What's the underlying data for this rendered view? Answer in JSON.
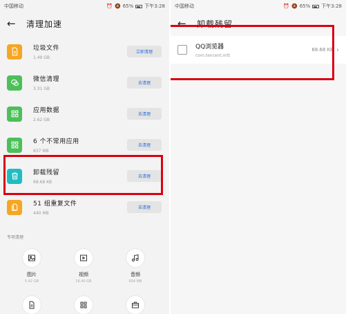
{
  "left": {
    "status": {
      "carrier": "中国移动",
      "battery": "65%",
      "time": "下午3:28"
    },
    "title": "清理加速",
    "items": [
      {
        "name": "垃圾文件",
        "size": "1.49 GB",
        "button": "立即清理",
        "color": "#f5a623",
        "icon": "document-icon"
      },
      {
        "name": "微信清理",
        "size": "3.31 GB",
        "button": "去清理",
        "color": "#4cbf59",
        "icon": "wechat-icon"
      },
      {
        "name": "应用数据",
        "size": "2.62 GB",
        "button": "去清理",
        "color": "#4cbf59",
        "icon": "apps-grid-icon"
      },
      {
        "name": "6 个不常用应用",
        "size": "837 MB",
        "button": "去清理",
        "color": "#4cbf59",
        "icon": "apps-grid-icon"
      },
      {
        "name": "卸载残留",
        "size": "68.68 KB",
        "button": "去清理",
        "color": "#1fbdc2",
        "icon": "trash-icon"
      },
      {
        "name": "51 组重复文件",
        "size": "440 MB",
        "button": "去清理",
        "color": "#f5a623",
        "icon": "duplicate-file-icon"
      }
    ],
    "special_title": "专项清理",
    "special": [
      {
        "label": "图片",
        "size": "5.42 GB",
        "icon": "image-icon"
      },
      {
        "label": "视频",
        "size": "16.40 GB",
        "icon": "video-icon"
      },
      {
        "label": "音频",
        "size": "604 MB",
        "icon": "music-icon"
      },
      {
        "label": "",
        "size": "",
        "icon": "file-icon"
      },
      {
        "label": "",
        "size": "",
        "icon": "apps-grid-icon"
      },
      {
        "label": "",
        "size": "",
        "icon": "briefcase-icon"
      }
    ]
  },
  "right": {
    "status": {
      "carrier": "中国移动",
      "battery": "65%",
      "time": "下午3:28"
    },
    "title": "卸载残留",
    "item": {
      "name": "QQ浏览器",
      "package": "com.tencent.mtt",
      "size": "68.68 KB"
    }
  },
  "colors": {
    "highlight": "#d9000f",
    "button_text": "#2b6fd8"
  }
}
